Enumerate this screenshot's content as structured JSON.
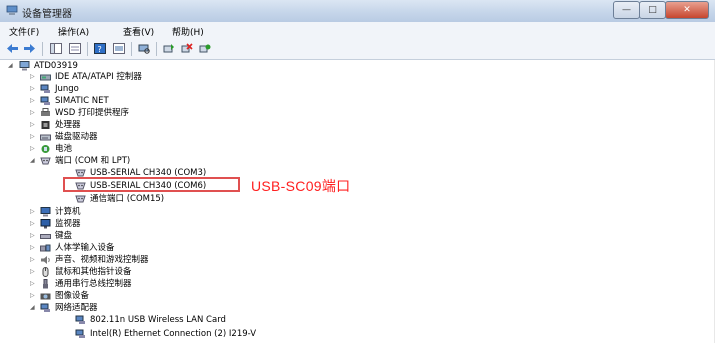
{
  "window": {
    "title": "设备管理器",
    "min_label": "—",
    "max_label": "□",
    "close_label": "✕"
  },
  "menu": [
    {
      "label": "文件(F)"
    },
    {
      "label": "操作(A)"
    },
    {
      "label": "查看(V)"
    },
    {
      "label": "帮助(H)"
    }
  ],
  "tree": {
    "root": "ATD03919",
    "items": [
      {
        "label": "IDE ATA/ATAPI 控制器",
        "icon": "ide-controller-icon",
        "expander": "▷"
      },
      {
        "label": "Jungo",
        "icon": "network-adapter-icon",
        "expander": "▷"
      },
      {
        "label": "SIMATIC NET",
        "icon": "network-adapter-icon",
        "expander": "▷"
      },
      {
        "label": "WSD 打印提供程序",
        "icon": "printer-icon",
        "expander": "▷"
      },
      {
        "label": "处理器",
        "icon": "processor-icon",
        "expander": "▷"
      },
      {
        "label": "磁盘驱动器",
        "icon": "disk-drive-icon",
        "expander": "▷"
      },
      {
        "label": "电池",
        "icon": "battery-icon",
        "expander": "▷"
      },
      {
        "label": "端口 (COM 和 LPT)",
        "icon": "port-icon",
        "expander": "◢"
      },
      {
        "label": "USB-SERIAL CH340 (COM3)",
        "icon": "port-icon",
        "expander": ""
      },
      {
        "label": "USB-SERIAL CH340 (COM6)",
        "icon": "port-icon",
        "expander": ""
      },
      {
        "label": "通信端口 (COM15)",
        "icon": "port-icon",
        "expander": ""
      },
      {
        "label": "计算机",
        "icon": "computer-icon",
        "expander": "▷"
      },
      {
        "label": "监视器",
        "icon": "monitor-icon",
        "expander": "▷"
      },
      {
        "label": "键盘",
        "icon": "keyboard-icon",
        "expander": "▷"
      },
      {
        "label": "人体学输入设备",
        "icon": "hid-icon",
        "expander": "▷"
      },
      {
        "label": "声音、视频和游戏控制器",
        "icon": "sound-icon",
        "expander": "▷"
      },
      {
        "label": "鼠标和其他指针设备",
        "icon": "mouse-icon",
        "expander": "▷"
      },
      {
        "label": "通用串行总线控制器",
        "icon": "usb-icon",
        "expander": "▷"
      },
      {
        "label": "图像设备",
        "icon": "camera-icon",
        "expander": "▷"
      },
      {
        "label": "网络适配器",
        "icon": "network-adapter-icon",
        "expander": "◢"
      },
      {
        "label": "802.11n USB Wireless LAN Card",
        "icon": "network-adapter-icon",
        "expander": ""
      },
      {
        "label": "Intel(R) Ethernet Connection (2) I219-V",
        "icon": "network-adapter-icon",
        "expander": ""
      }
    ]
  },
  "annotation": {
    "text": "USB-SC09端口",
    "color": "#ff2020"
  }
}
